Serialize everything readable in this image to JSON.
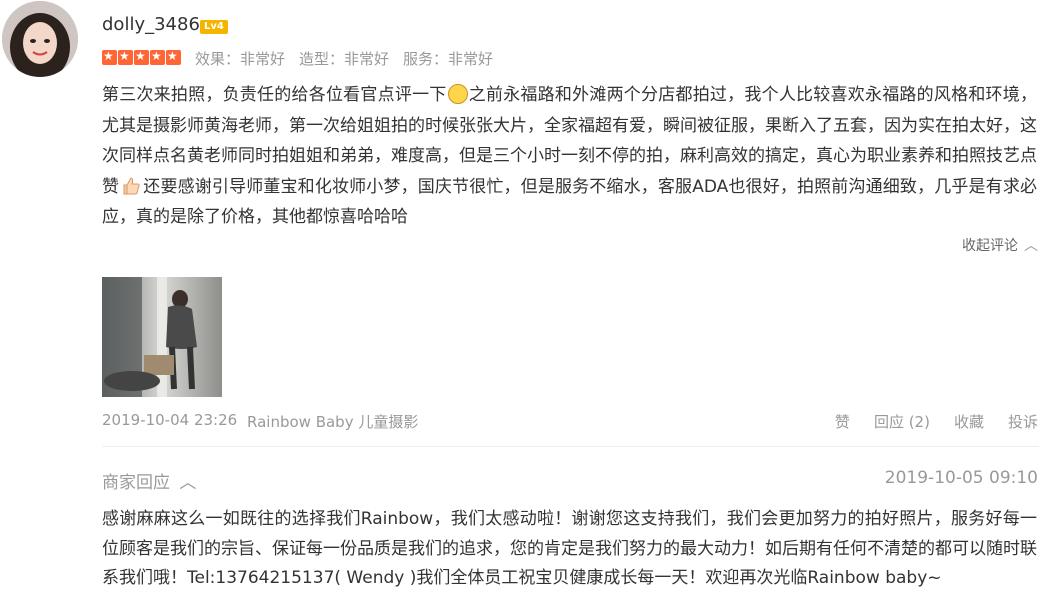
{
  "user": {
    "name": "dolly_3486",
    "level": "Lv4"
  },
  "rating": {
    "stars": 5,
    "effect": "效果：非常好",
    "style": "造型：非常好",
    "service": "服务：非常好"
  },
  "review": {
    "part1": "第三次来拍照，负责任的给各位看官点评一下",
    "part2": "之前永福路和外滩两个分店都拍过，我个人比较喜欢永福路的风格和环境，尤其是摄影师黄海老师，第一次给姐姐拍的时候张张大片，全家福超有爱，瞬间被征服，果断入了五套，因为实在拍太好，这次同样点名黄老师同时拍姐姐和弟弟，难度高，但是三个小时一刻不停的拍，麻利高效的搞定，真心为职业素养和拍照技艺点赞",
    "part3": "还要感谢引导师董宝和化妆师小梦，国庆节很忙，但是服务不缩水，客服ADA也很好，拍照前沟通细致，几乎是有求必应，真的是除了价格，其他都惊喜哈哈哈"
  },
  "collapse_label": "收起评论",
  "meta": {
    "datetime": "2019-10-04 23:26",
    "shop": "Rainbow Baby 儿童摄影"
  },
  "actions": {
    "like": "赞",
    "reply": "回应 (2)",
    "favorite": "收藏",
    "report": "投诉"
  },
  "merchant_reply": {
    "label": "商家回应",
    "datetime": "2019-10-05 09:10",
    "text": "感谢麻麻这么一如既往的选择我们Rainbow，我们太感动啦！谢谢您这支持我们，我们会更加努力的拍好照片，服务好每一位顾客是我们的宗旨、保证每一份品质是我们的追求，您的肯定是我们努力的最大动力！如后期有任何不清楚的都可以随时联系我们哦！Tel:13764215137( Wendy )我们全体员工祝宝贝健康成长每一天！欢迎再次光临Rainbow baby~"
  },
  "colors": {
    "star": "#ff6633",
    "badge": "#f4b400",
    "muted": "#999999"
  }
}
